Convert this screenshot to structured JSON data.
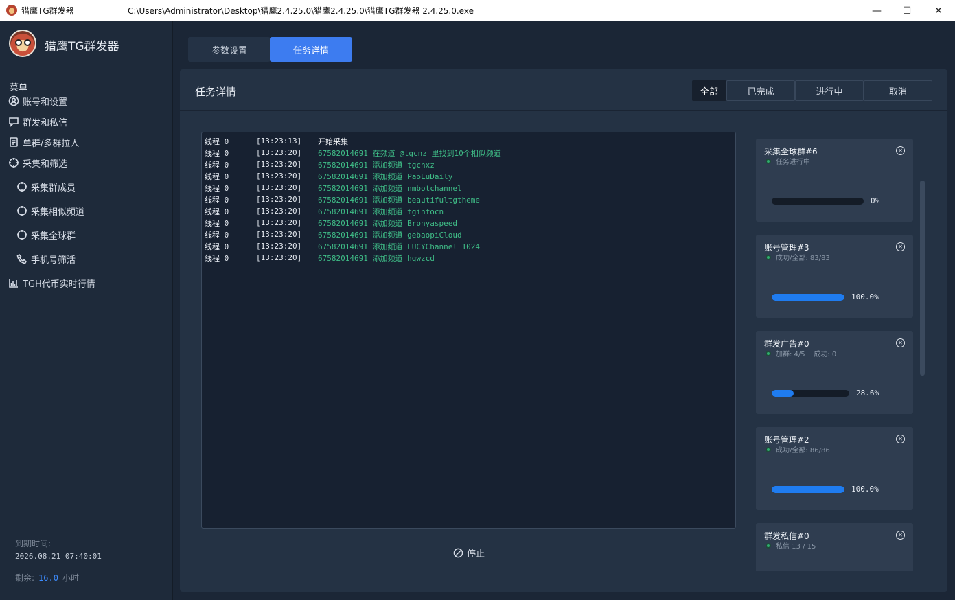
{
  "window": {
    "app_name": "猎鹰TG群发器",
    "path": "C:\\Users\\Administrator\\Desktop\\猎鹰2.4.25.0\\猎鹰2.4.25.0\\猎鹰TG群发器 2.4.25.0.exe",
    "minimize": "—",
    "maximize": "☐",
    "close": "✕"
  },
  "sidebar": {
    "brand": "猎鹰TG群发器",
    "menu_title": "菜单",
    "items": [
      {
        "label": "账号和设置",
        "icon": "user-circle-icon"
      },
      {
        "label": "群发和私信",
        "icon": "chat-bubble-icon"
      },
      {
        "label": "单群/多群拉人",
        "icon": "document-icon"
      },
      {
        "label": "采集和筛选",
        "icon": "crosshair-icon"
      },
      {
        "label": "采集群成员",
        "icon": "crosshair-icon"
      },
      {
        "label": "采集相似频道",
        "icon": "crosshair-icon"
      },
      {
        "label": "采集全球群",
        "icon": "crosshair-icon"
      },
      {
        "label": "手机号筛活",
        "icon": "phone-icon"
      },
      {
        "label": "TGH代币实时行情",
        "icon": "chart-icon"
      }
    ],
    "expire_label": "到期时间:",
    "expire_date": "2026.08.21 07:40:01",
    "remain_label": "剩余:",
    "remain_value": "16.0",
    "remain_unit": "小时"
  },
  "tabs": {
    "params": "参数设置",
    "details": "任务详情"
  },
  "panel": {
    "title": "任务详情",
    "filters": [
      "全部",
      "已完成",
      "进行中",
      "取消"
    ],
    "stop_label": "停止"
  },
  "log": [
    {
      "thread": "线程 0",
      "time": "[13:23:13]",
      "msg": "开始采集",
      "white": true
    },
    {
      "thread": "线程 0",
      "time": "[13:23:20]",
      "msg": "67582014691 在频道 @tgcnz 里找到10个相似频道"
    },
    {
      "thread": "线程 0",
      "time": "[13:23:20]",
      "msg": "67582014691 添加频道 tgcnxz"
    },
    {
      "thread": "线程 0",
      "time": "[13:23:20]",
      "msg": "67582014691 添加频道 PaoLuDaily"
    },
    {
      "thread": "线程 0",
      "time": "[13:23:20]",
      "msg": "67582014691 添加频道 nmbotchannel"
    },
    {
      "thread": "线程 0",
      "time": "[13:23:20]",
      "msg": "67582014691 添加频道 beautifultgtheme"
    },
    {
      "thread": "线程 0",
      "time": "[13:23:20]",
      "msg": "67582014691 添加频道 tginfocn"
    },
    {
      "thread": "线程 0",
      "time": "[13:23:20]",
      "msg": "67582014691 添加频道 Bronyaspeed"
    },
    {
      "thread": "线程 0",
      "time": "[13:23:20]",
      "msg": "67582014691 添加频道 gebaopiCloud"
    },
    {
      "thread": "线程 0",
      "time": "[13:23:20]",
      "msg": "67582014691 添加频道 LUCYChannel_1024"
    },
    {
      "thread": "线程 0",
      "time": "[13:23:20]",
      "msg": "67582014691 添加频道 hgwzcd"
    }
  ],
  "tasks": [
    {
      "name": "采集全球群#6",
      "status": "任务进行中",
      "progress": 0,
      "pct": "0%"
    },
    {
      "name": "账号管理#3",
      "status": "成功/全部: 83/83",
      "progress": 1.0,
      "pct": "100.0%"
    },
    {
      "name": "群发广告#0",
      "status": "加群: 4/5    成功: 0",
      "progress": 0.286,
      "pct": "28.6%"
    },
    {
      "name": "账号管理#2",
      "status": "成功/全部: 86/86",
      "progress": 1.0,
      "pct": "100.0%"
    },
    {
      "name": "群发私信#0",
      "status": "私信 13 / 15",
      "progress": null,
      "pct": ""
    }
  ],
  "colors": {
    "accent": "#3d7cf0",
    "log_green": "#3fbd87",
    "progress_blue": "#1f7cf0",
    "status_dot": "#2fae6e"
  }
}
